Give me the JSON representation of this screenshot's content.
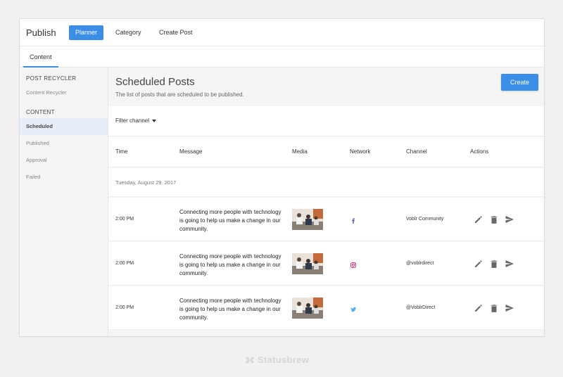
{
  "app": {
    "title": "Publish"
  },
  "nav": [
    {
      "label": "Planner",
      "active": true
    },
    {
      "label": "Category",
      "active": false
    },
    {
      "label": "Create Post",
      "active": false
    }
  ],
  "tabs": [
    {
      "label": "Content",
      "active": true
    }
  ],
  "sidebar": {
    "sections": [
      {
        "heading": "POST RECYCLER",
        "items": [
          {
            "label": "Content Recycler",
            "active": false
          }
        ]
      },
      {
        "heading": "CONTENT",
        "items": [
          {
            "label": "Scheduled",
            "active": true
          },
          {
            "label": "Published",
            "active": false
          },
          {
            "label": "Approval",
            "active": false
          },
          {
            "label": "Failed",
            "active": false
          }
        ]
      }
    ]
  },
  "main": {
    "title": "Scheduled Posts",
    "subtitle": "The list of posts that are scheduled to be published.",
    "create_label": "Create",
    "filter_label": "Filter channel"
  },
  "table": {
    "columns": [
      "Time",
      "Message",
      "Media",
      "Network",
      "Channel",
      "Actions"
    ],
    "date_group": "Tuesday, August 29, 2017",
    "rows": [
      {
        "time": "2:00 PM",
        "message": "Connecting more people with technology is going to help us make a change in our community.",
        "network": "facebook-icon",
        "channel": "Voblr Community"
      },
      {
        "time": "2:00 PM",
        "message": "Connecting more people with technology is going to help us make a change in our community.",
        "network": "instagram-icon",
        "channel": "@voblrdirect"
      },
      {
        "time": "2:00 PM",
        "message": "Connecting more people with technology is going to help us make a change in our community.",
        "network": "twitter-icon",
        "channel": "@VoblrDirect"
      }
    ]
  },
  "brand": {
    "name": "Statusbrew"
  },
  "colors": {
    "accent": "#3a8ee6",
    "facebook": "#3b5998",
    "instagram": "#e1306c",
    "twitter": "#55acee",
    "icon": "#666666"
  }
}
